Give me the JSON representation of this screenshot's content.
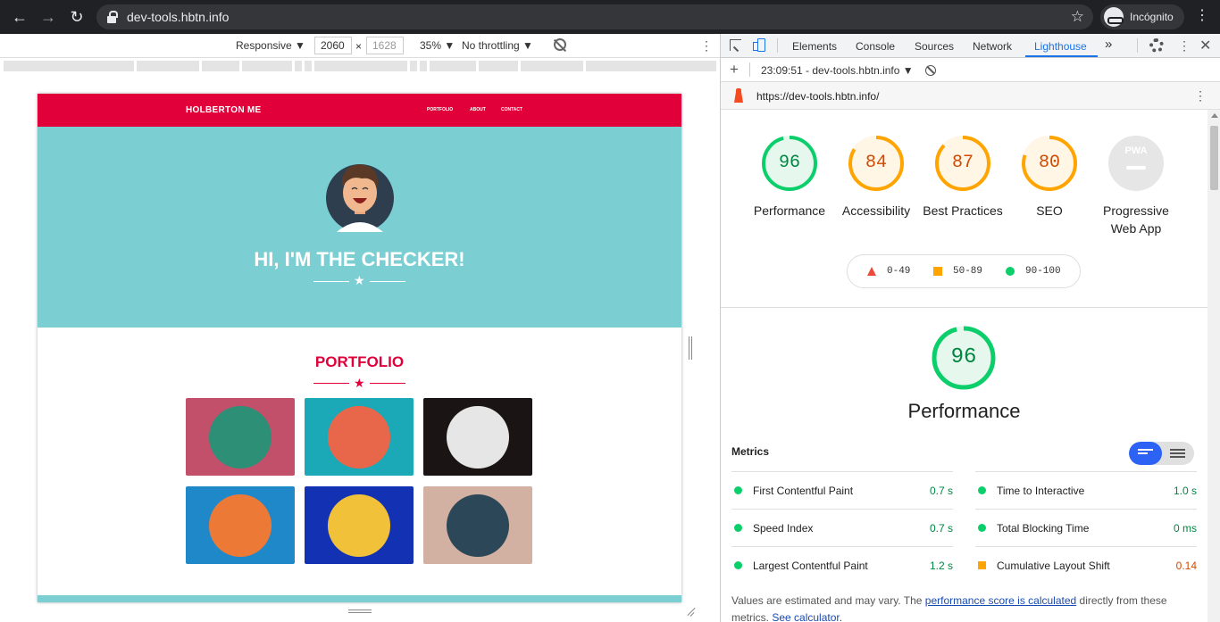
{
  "browser": {
    "url": "dev-tools.hbtn.info",
    "profile_label": "Incógnito"
  },
  "device_toolbar": {
    "device": "Responsive",
    "width": "2060",
    "height": "1628",
    "zoom": "35%",
    "throttling": "No throttling"
  },
  "site": {
    "brand": "HOLBERTON ME",
    "nav": [
      "PORTFOLIO",
      "ABOUT",
      "CONTACT"
    ],
    "hero_title": "HI, I'M THE CHECKER!",
    "portfolio_title": "PORTFOLIO",
    "colors": {
      "primary": "#e1003a",
      "hero_bg": "#7bcfd3"
    },
    "tiles": [
      {
        "icon": "cabin-icon",
        "bg": "#c2506a",
        "circle": "#2e8f77"
      },
      {
        "icon": "cake-icon",
        "bg": "#1ba9b8",
        "circle": "#e8664a"
      },
      {
        "icon": "circus-tent-icon",
        "bg": "#1b1414",
        "circle": "#e6e6e6"
      },
      {
        "icon": "gamepad-icon",
        "bg": "#1e88c9",
        "circle": "#ec7a36"
      },
      {
        "icon": "safe-icon",
        "bg": "#1332b3",
        "circle": "#f1c13a"
      },
      {
        "icon": "submarine-icon",
        "bg": "#d3b1a2",
        "circle": "#2c4758"
      }
    ]
  },
  "devtools": {
    "tabs": [
      "Elements",
      "Console",
      "Sources",
      "Network",
      "Lighthouse"
    ],
    "active_tab": "Lighthouse",
    "more_tabs": "»",
    "report_time": "23:09:51 - dev-tools.hbtn.info",
    "report_url": "https://dev-tools.hbtn.info/"
  },
  "lighthouse": {
    "categories": [
      {
        "label": "Performance",
        "score": "96",
        "value": 96,
        "status": "pass"
      },
      {
        "label": "Accessibility",
        "score": "84",
        "value": 84,
        "status": "average"
      },
      {
        "label": "Best Practices",
        "score": "87",
        "value": 87,
        "status": "average"
      },
      {
        "label": "SEO",
        "score": "80",
        "value": 80,
        "status": "average"
      },
      {
        "label": "Progressive Web App",
        "score": "PWA",
        "value": null,
        "status": "na"
      }
    ],
    "legend": [
      "0-49",
      "50-89",
      "90-100"
    ],
    "colors": {
      "pass": "#0cce6b",
      "average": "#ffa400",
      "fail": "#ff4e42",
      "pass_text": "#018642",
      "average_text": "#d04900"
    },
    "performance": {
      "score": "96",
      "value": 96,
      "label": "Performance"
    },
    "metrics_title": "Metrics",
    "metrics": [
      {
        "name": "First Contentful Paint",
        "value": "0.7 s",
        "status": "pass"
      },
      {
        "name": "Time to Interactive",
        "value": "1.0 s",
        "status": "pass"
      },
      {
        "name": "Speed Index",
        "value": "0.7 s",
        "status": "pass"
      },
      {
        "name": "Total Blocking Time",
        "value": "0 ms",
        "status": "pass"
      },
      {
        "name": "Largest Contentful Paint",
        "value": "1.2 s",
        "status": "pass"
      },
      {
        "name": "Cumulative Layout Shift",
        "value": "0.14",
        "status": "average"
      }
    ],
    "footer": {
      "text1": "Values are estimated and may vary. The ",
      "link1": "performance score is calculated",
      "text2": " directly from these metrics. ",
      "link2": "See calculator."
    }
  }
}
